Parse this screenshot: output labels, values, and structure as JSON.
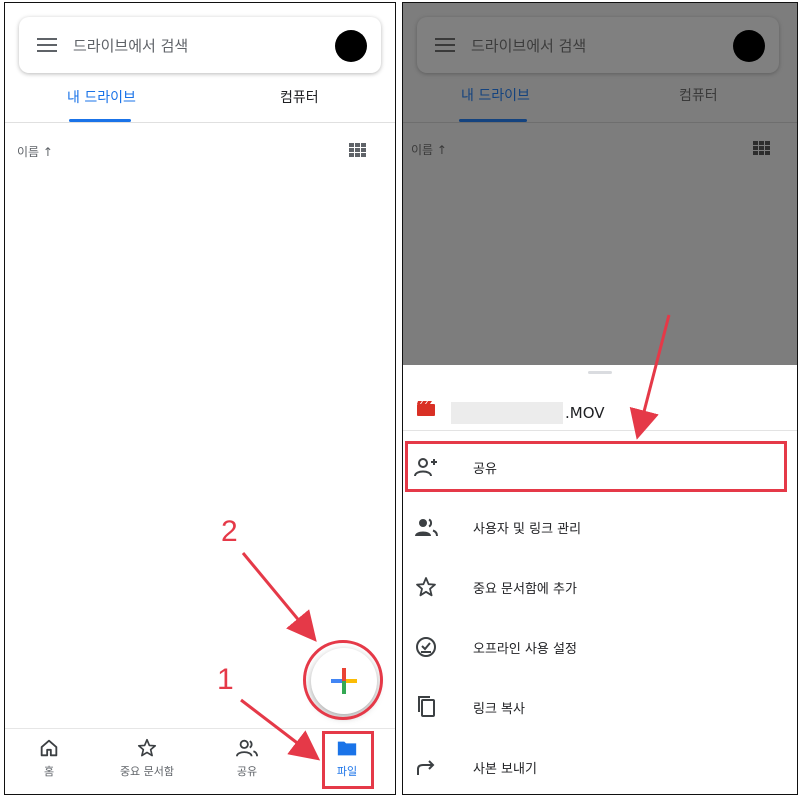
{
  "left_panel": {
    "search": {
      "placeholder": "드라이브에서 검색"
    },
    "tabs": [
      {
        "label": "내 드라이브",
        "active": true
      },
      {
        "label": "컴퓨터",
        "active": false
      }
    ],
    "sort_label": "이름 ↑",
    "view_toggle_icon": "grid-view-icon",
    "fab": {
      "icon": "plus-multicolor-icon"
    },
    "bottom_nav": [
      {
        "label": "홈",
        "icon": "home-icon",
        "active": false
      },
      {
        "label": "중요 문서함",
        "icon": "star-icon",
        "active": false
      },
      {
        "label": "공유",
        "icon": "people-icon",
        "active": false
      },
      {
        "label": "파일",
        "icon": "folder-icon",
        "active": true
      }
    ],
    "annotations": {
      "step1": "1",
      "step2": "2"
    }
  },
  "right_panel": {
    "search": {
      "placeholder": "드라이브에서 검색"
    },
    "tabs": [
      {
        "label": "내 드라이브",
        "active": true
      },
      {
        "label": "컴퓨터",
        "active": false
      }
    ],
    "sort_label": "이름 ↑",
    "sheet": {
      "file_name_suffix": ".MOV",
      "file_icon": "video-file-icon",
      "menu": [
        {
          "label": "공유",
          "icon": "add-person-icon"
        },
        {
          "label": "사용자 및 링크 관리",
          "icon": "manage-people-icon"
        },
        {
          "label": "중요 문서함에 추가",
          "icon": "star-outline-icon"
        },
        {
          "label": "오프라인 사용 설정",
          "icon": "offline-check-icon"
        },
        {
          "label": "링크 복사",
          "icon": "copy-icon"
        },
        {
          "label": "사본 보내기",
          "icon": "forward-arrow-icon"
        }
      ]
    }
  },
  "colors": {
    "accent_blue": "#1a73e8",
    "annotation_red": "#e53948",
    "scrim_gray": "#7d7d7d",
    "video_red": "#d93025"
  }
}
